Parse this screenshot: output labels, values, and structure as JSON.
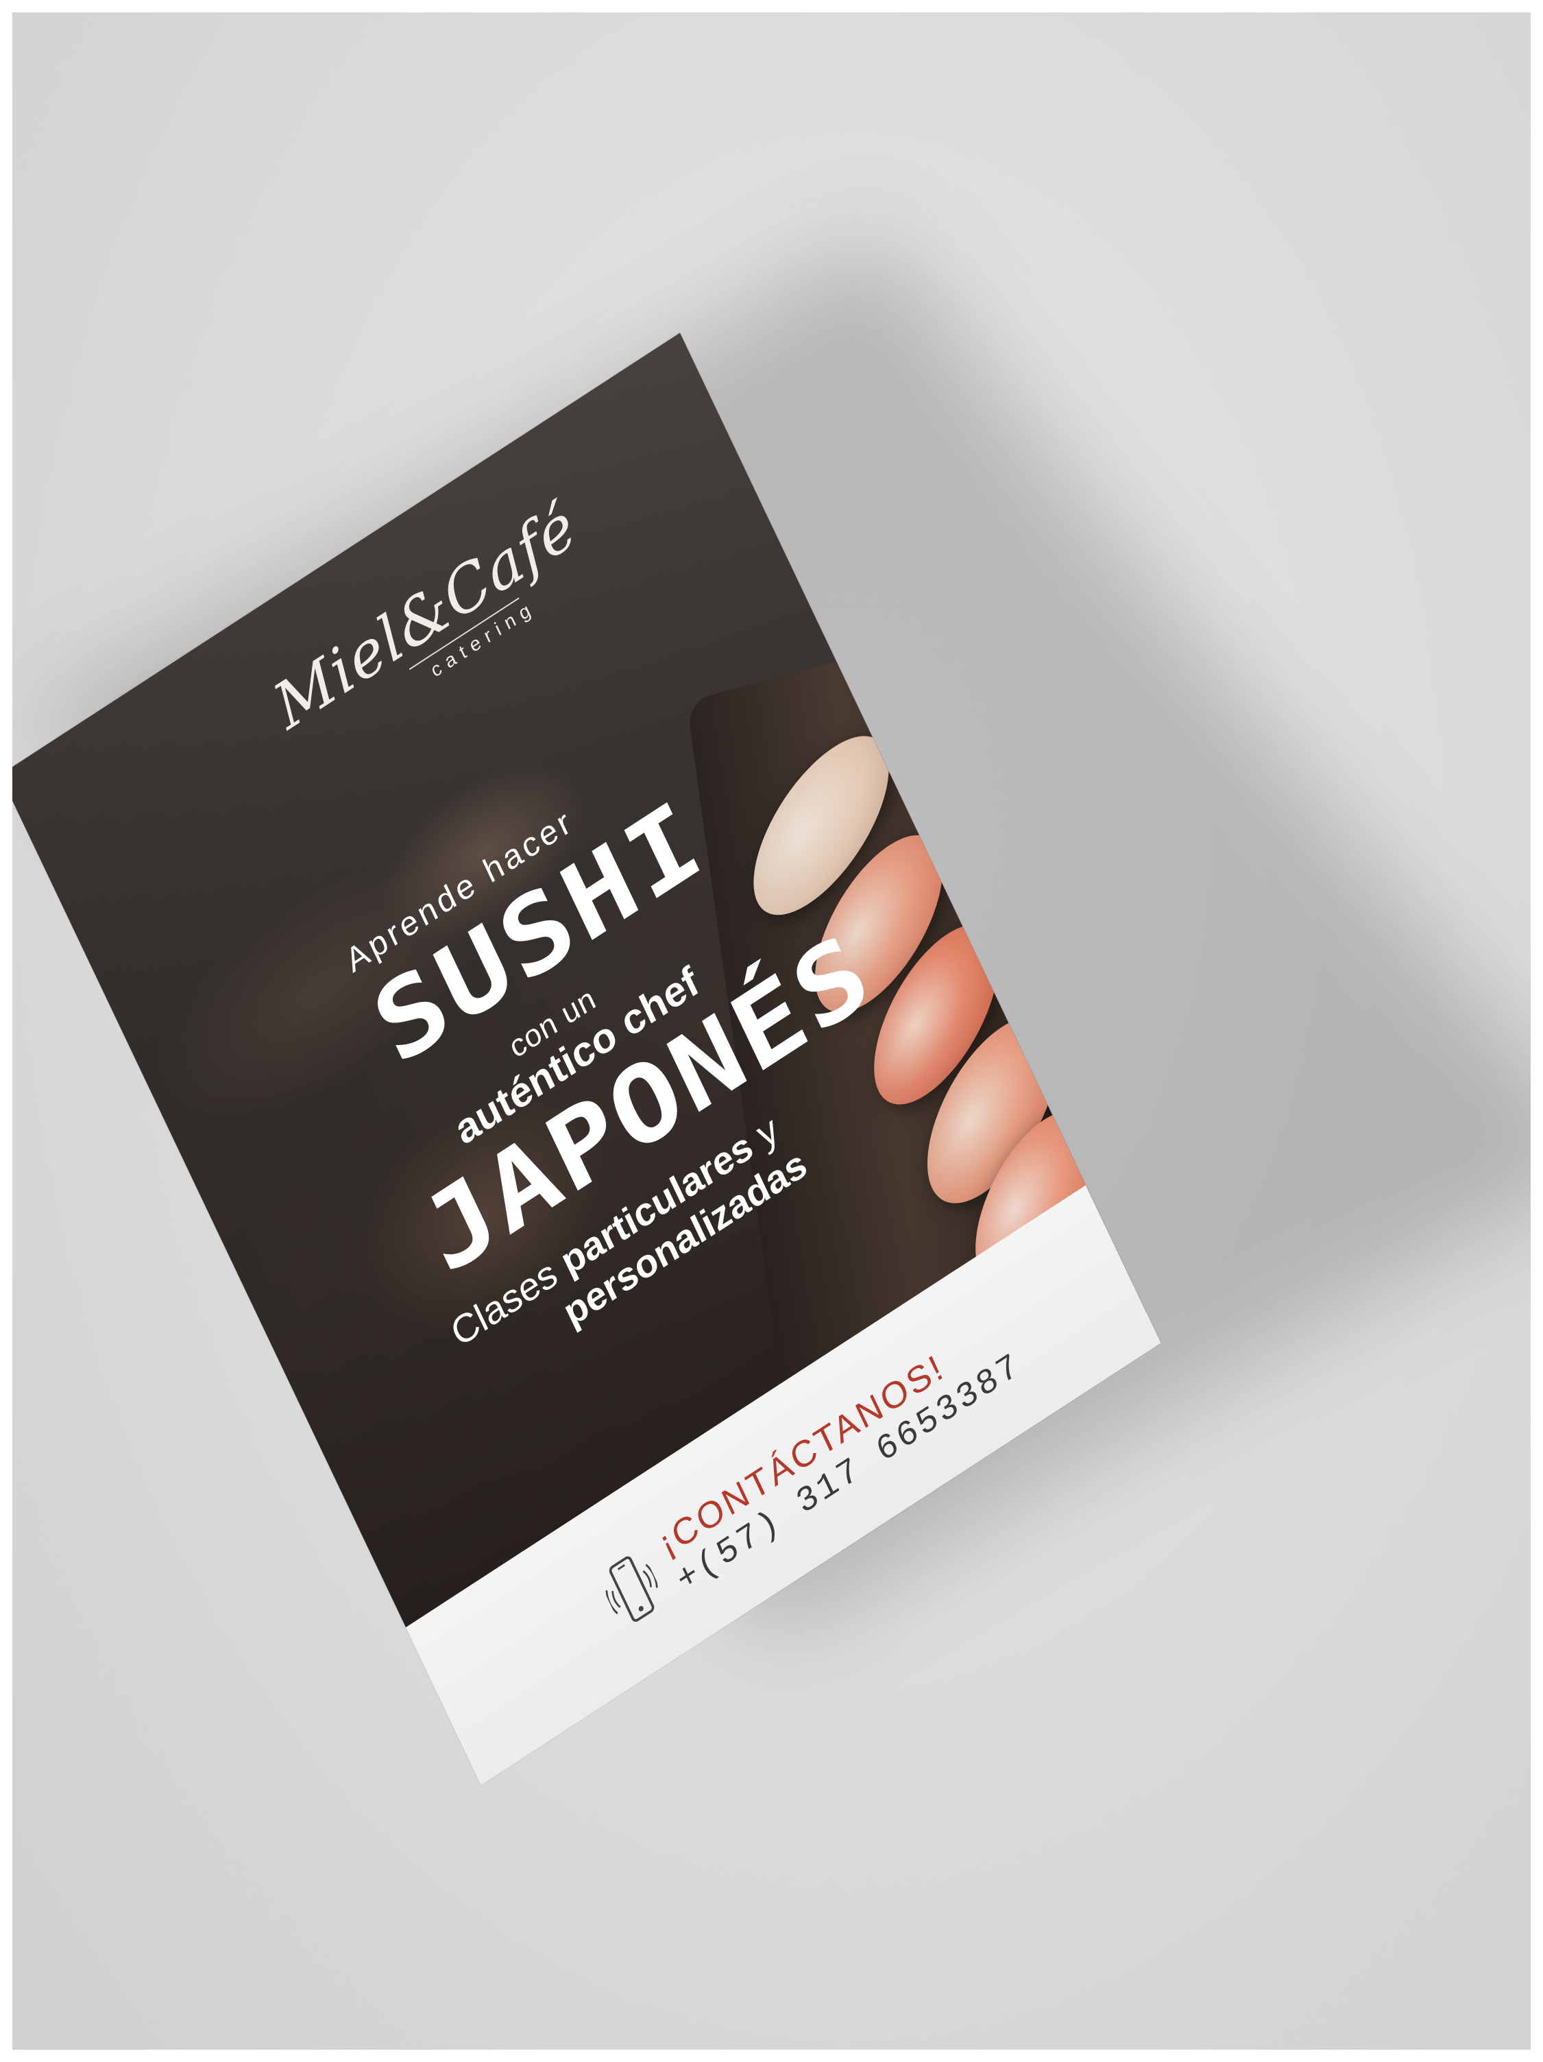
{
  "logo": {
    "name": "Miel&Café",
    "subtitle": "catering"
  },
  "headline": {
    "line1": "Aprende hacer",
    "line2": "SUSHI",
    "line3": "con un",
    "line4": "auténtico chef",
    "line5": "JAPONÉS",
    "line6_thin": "Clases ",
    "line6_bold": "particulares",
    "line6_tail": " y",
    "line7": "personalizadas"
  },
  "contact": {
    "cta": "¡CONTÁCTANOS!",
    "phone": "+(57) 317 6653387",
    "icon": "phone-icon"
  },
  "colors": {
    "background": "#d9d9d9",
    "accent": "#b5382a",
    "footer": "#f0f0f0"
  }
}
